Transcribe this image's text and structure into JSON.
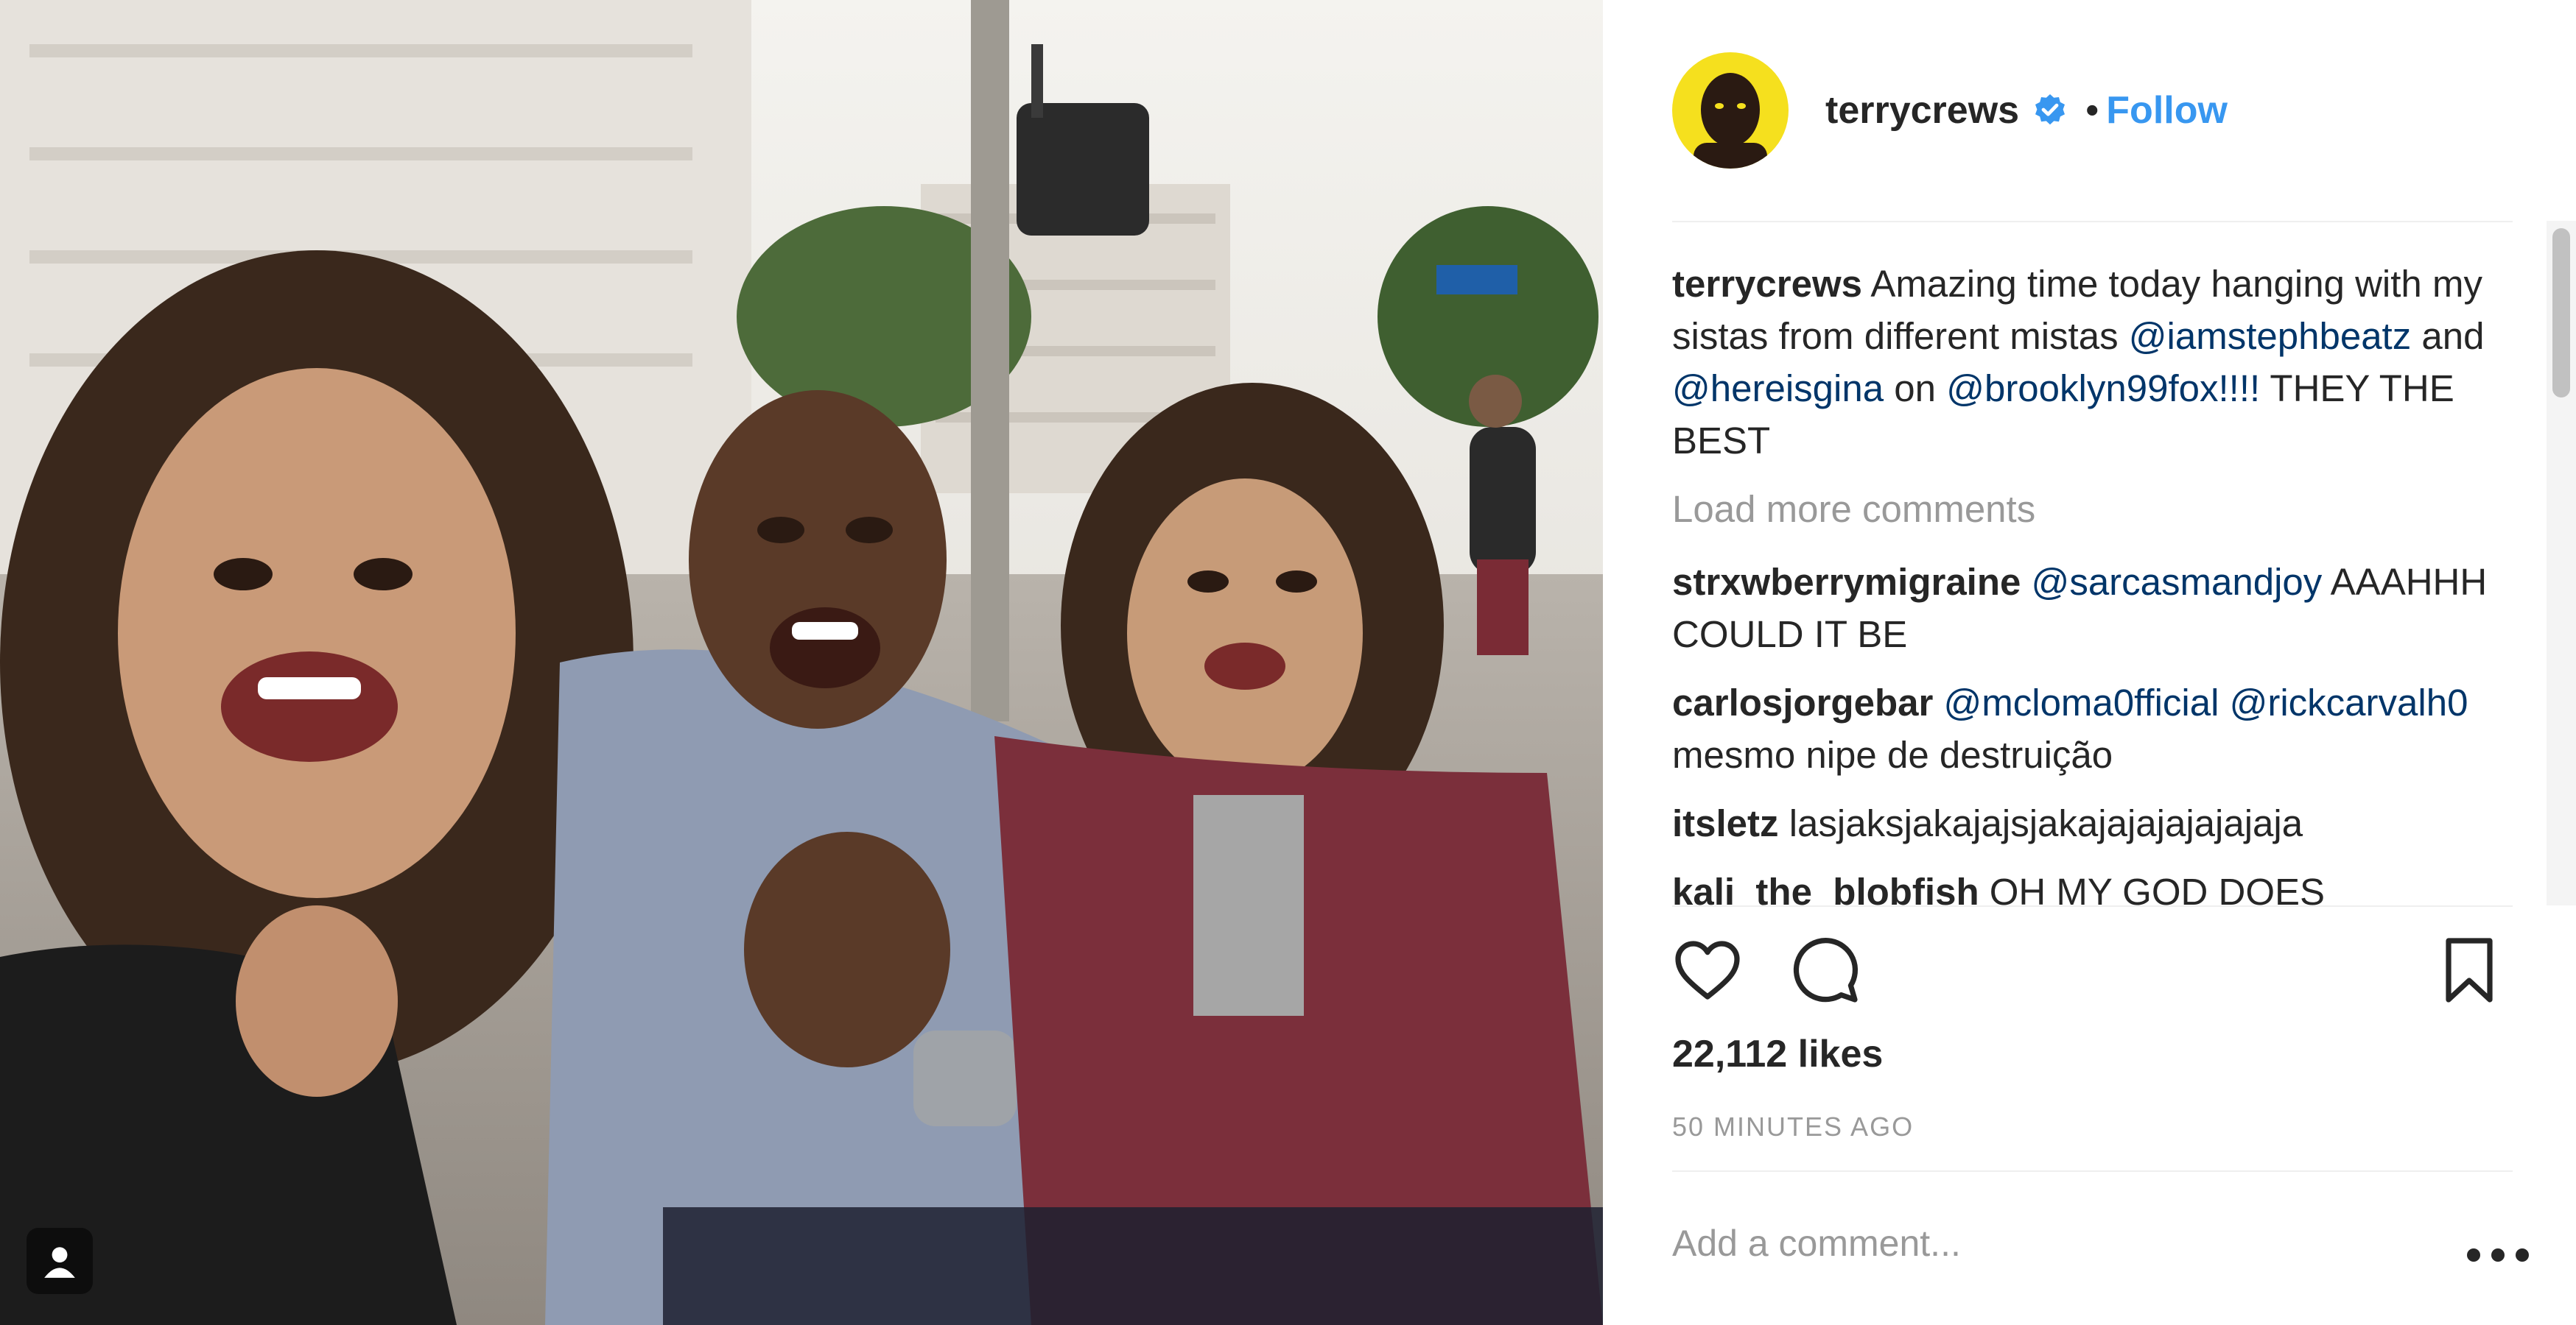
{
  "post": {
    "photo_alt": "",
    "tag_icon": "user-tag-icon"
  },
  "header": {
    "avatar_icon": "profile-avatar",
    "username": "terrycrews",
    "verified_icon": "verified-badge-icon",
    "separator": "•",
    "follow_label": "Follow",
    "follow_color": "#3897f0"
  },
  "caption": {
    "username": "terrycrews",
    "text_1": " Amazing time today hanging with my sistas from different mistas ",
    "mention_1": "@iamstephbeatz",
    "text_2": " and ",
    "mention_2": "@hereisgina",
    "text_3": " on ",
    "mention_3": "@brooklyn99fox!!!!",
    "text_4": " THEY THE BEST"
  },
  "load_more": "Load more comments",
  "comments": [
    {
      "user": "strxwberrymigraine",
      "mention": "@sarcasmandjoy",
      "text": " AAAHHH COULD IT BE"
    },
    {
      "user": "carlosjorgebar",
      "mention": "@mcloma0fficial @rickcarvalh0",
      "text": " mesmo nipe de destruição"
    },
    {
      "user": "itsletz",
      "mention": "",
      "text": " lasjaksjakajajsjakajajajajajajaja"
    },
    {
      "user": "kali_the_blobfish",
      "mention": "",
      "text": " OH MY GOD DOES"
    }
  ],
  "actions": {
    "like_icon": "heart-icon",
    "comment_icon": "comment-bubble-icon",
    "save_icon": "bookmark-icon"
  },
  "likes": "22,112 likes",
  "timestamp": "50 MINUTES AGO",
  "comment_box": {
    "placeholder": "Add a comment...",
    "more_icon": "more-options-icon"
  }
}
